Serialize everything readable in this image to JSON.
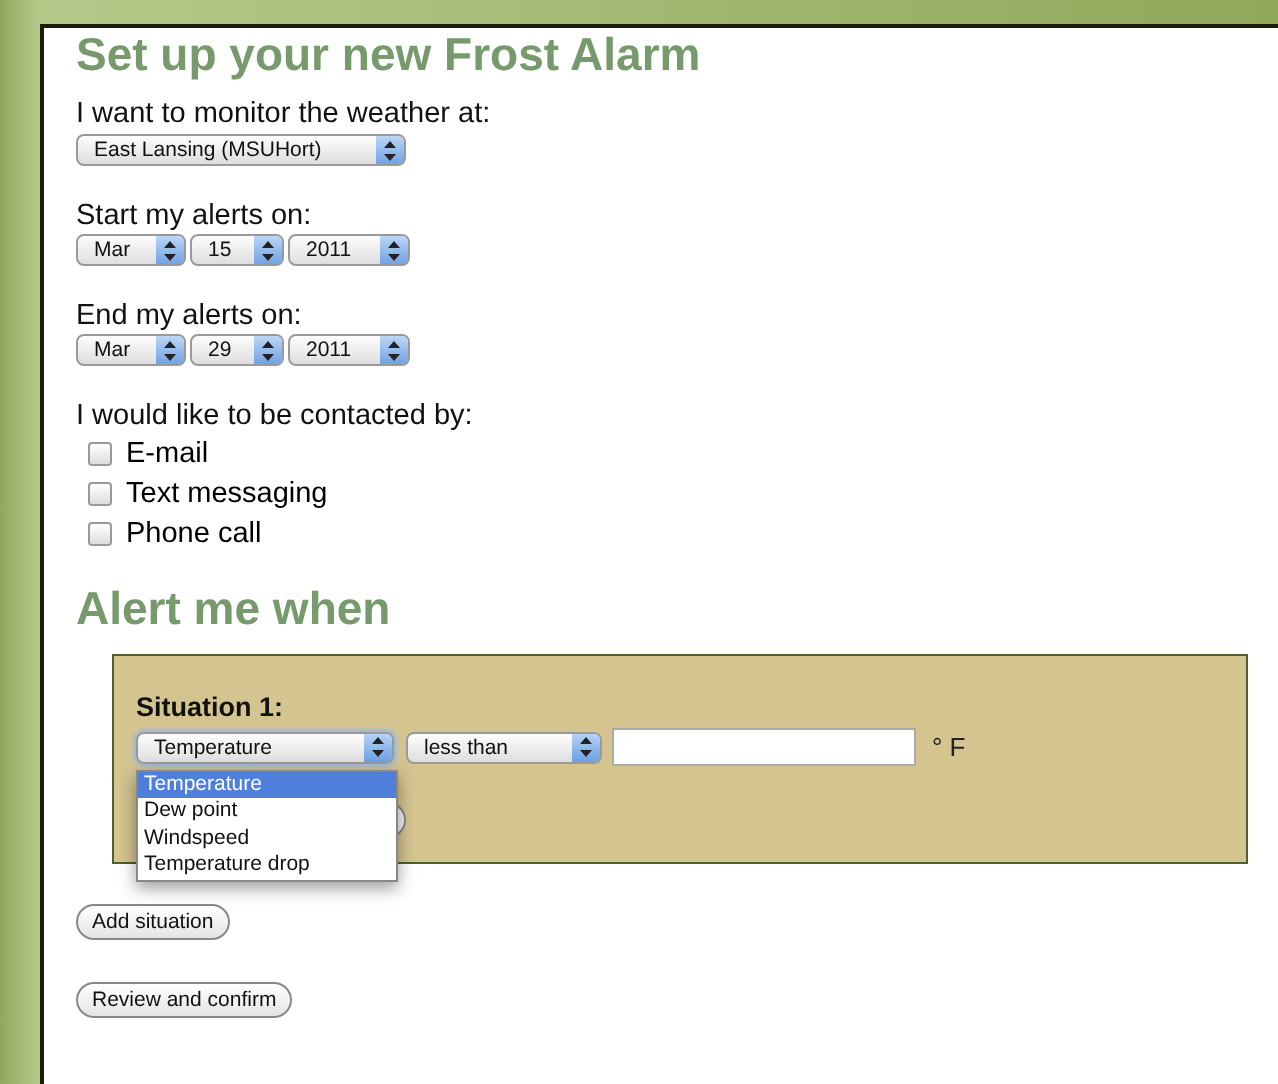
{
  "title": "Set up your new Frost Alarm",
  "location": {
    "label": "I want to monitor the weather at:",
    "value": "East Lansing (MSUHort)"
  },
  "start": {
    "label": "Start my alerts on:",
    "month": "Mar",
    "day": "15",
    "year": "2011"
  },
  "end": {
    "label": "End my alerts on:",
    "month": "Mar",
    "day": "29",
    "year": "2011"
  },
  "contact": {
    "label": "I would like to be contacted by:",
    "options": [
      {
        "label": "E-mail",
        "checked": false
      },
      {
        "label": "Text messaging",
        "checked": false
      },
      {
        "label": "Phone call",
        "checked": false
      }
    ]
  },
  "alert_heading": "Alert me when",
  "situation": {
    "label": "Situation 1:",
    "variable": "Temperature",
    "comparison": "less than",
    "unit": "° F",
    "dropdown": [
      {
        "label": "Temperature",
        "selected": true
      },
      {
        "label": "Dew point",
        "selected": false
      },
      {
        "label": "Windspeed",
        "selected": false
      },
      {
        "label": "Temperature drop",
        "selected": false
      }
    ]
  },
  "buttons": [
    "Add situation",
    "Review and confirm"
  ]
}
